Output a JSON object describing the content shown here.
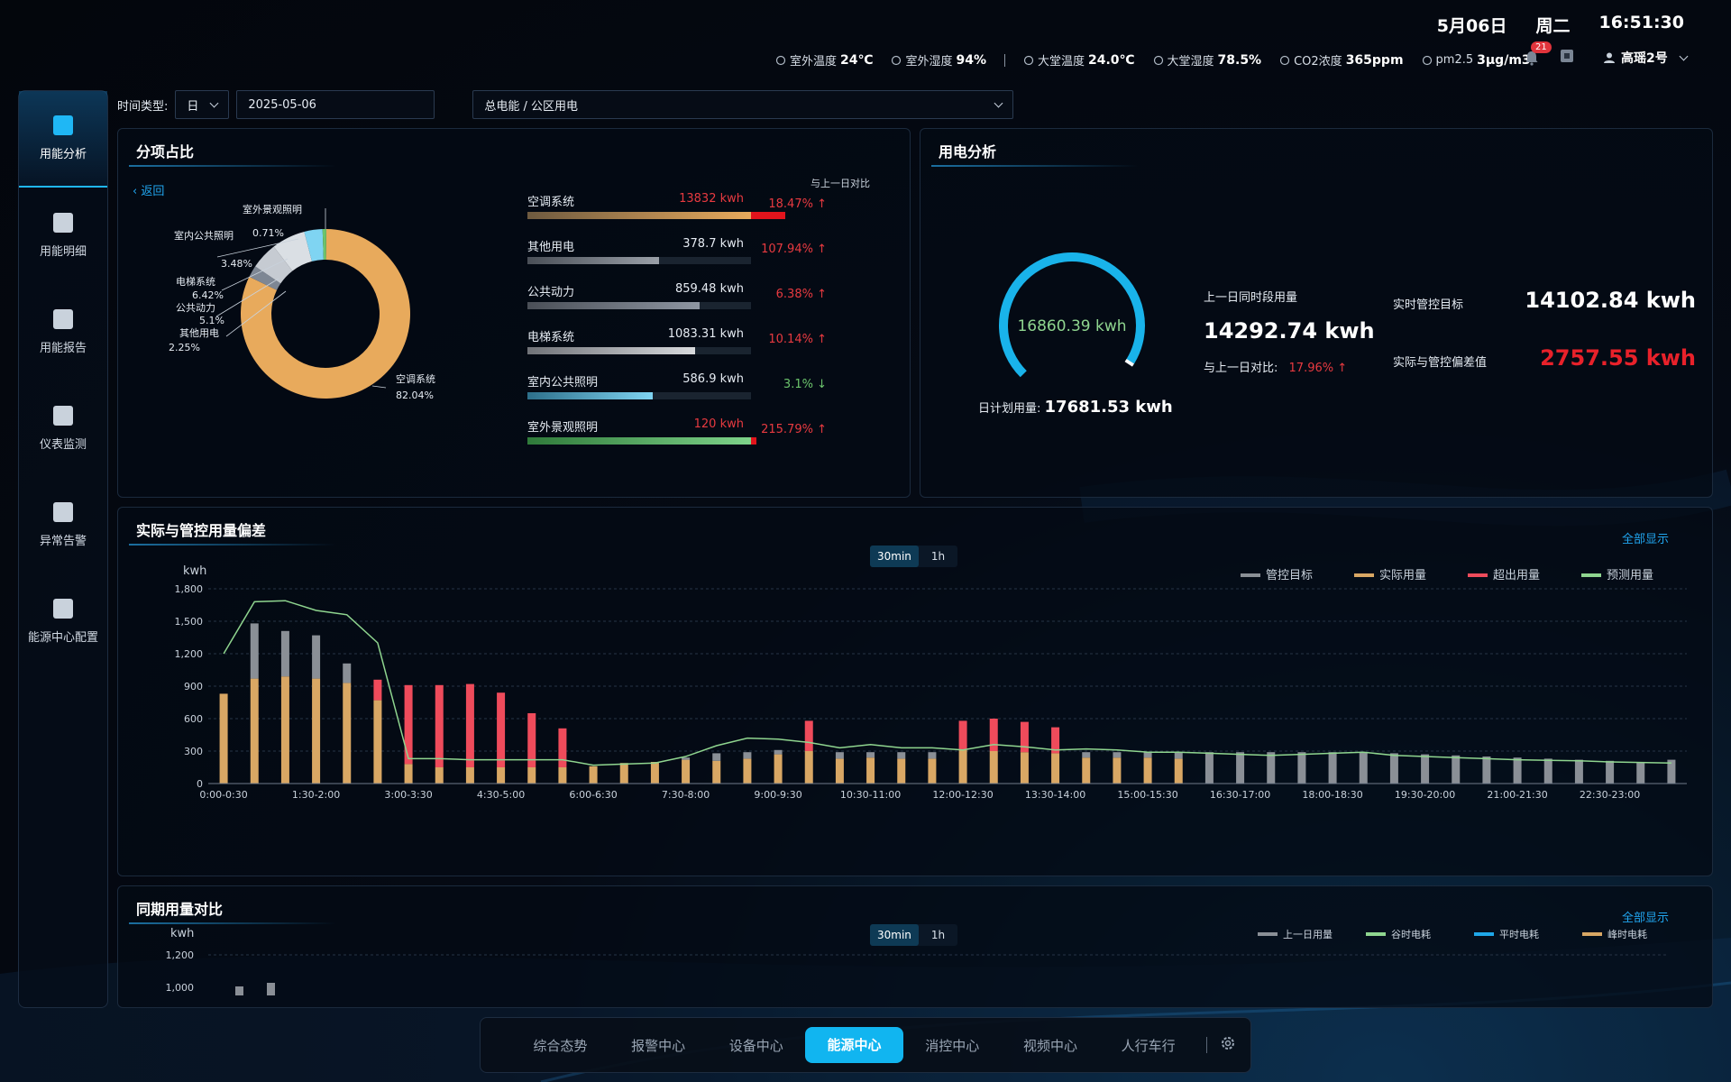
{
  "header": {
    "date": "5月06日",
    "weekday": "周二",
    "time": "16:51:30",
    "env": [
      {
        "label": "室外温度",
        "value": "24℃",
        "icon": "thermometer-icon"
      },
      {
        "label": "室外湿度",
        "value": "94%",
        "icon": "humidity-icon"
      },
      {
        "label": "大堂温度",
        "value": "24.0℃",
        "icon": "thermometer-icon"
      },
      {
        "label": "大堂湿度",
        "value": "78.5%",
        "icon": "droplet-icon"
      },
      {
        "label": "CO2浓度",
        "value": "365ppm",
        "icon": "cloud-icon"
      },
      {
        "label": "pm2.5",
        "value": "3μg/m3",
        "icon": "cloud-icon"
      }
    ],
    "notification_count": "21",
    "user_name": "高瑶2号"
  },
  "leftnav": [
    {
      "label": "用能分析",
      "icon": "bar-chart-icon",
      "active": true
    },
    {
      "label": "用能明细",
      "icon": "document-icon",
      "active": false
    },
    {
      "label": "用能报告",
      "icon": "clipboard-icon",
      "active": false
    },
    {
      "label": "仪表监测",
      "icon": "trend-icon",
      "active": false
    },
    {
      "label": "异常告警",
      "icon": "bell-icon",
      "active": false
    },
    {
      "label": "能源中心配置",
      "icon": "cube-icon",
      "active": false
    }
  ],
  "filters": {
    "time_type_label": "时间类型:",
    "time_type_value": "日",
    "date_value": "2025-05-06",
    "scope_value": "总电能 / 公区用电"
  },
  "share_panel": {
    "title": "分项占比",
    "back_label": "返回",
    "compare_header": "与上一日对比",
    "donut": {
      "labels": [
        {
          "name": "室外景观照明",
          "pct": "0.71%"
        },
        {
          "name": "室内公共照明",
          "pct": "3.48%"
        },
        {
          "name": "电梯系统",
          "pct": "6.42%"
        },
        {
          "name": "公共动力",
          "pct": "5.1%"
        },
        {
          "name": "其他用电",
          "pct": "2.25%"
        },
        {
          "name": "空调系统",
          "pct": "82.04%"
        }
      ],
      "values": [
        82.04,
        2.25,
        5.1,
        6.42,
        3.48,
        0.71
      ],
      "colors": [
        "#e8aa5c",
        "#7e8794",
        "#c6cbd2",
        "#dadfe4",
        "#7fd4f2",
        "#6cc46c"
      ]
    },
    "items": [
      {
        "name": "空调系统",
        "value": "13832 kwh",
        "value_red": true,
        "fill": 1.0,
        "overflow": true,
        "color": "linear-gradient(90deg,#6e5a40,#e8aa5c)",
        "pct": "18.47%",
        "dir": "↑",
        "up": true
      },
      {
        "name": "其他用电",
        "value": "378.7 kwh",
        "value_red": false,
        "fill": 0.59,
        "overflow": false,
        "color": "linear-gradient(90deg,#4a4f57,#9aa0a8)",
        "pct": "107.94%",
        "dir": "↑",
        "up": true
      },
      {
        "name": "公共动力",
        "value": "859.48 kwh",
        "value_red": false,
        "fill": 0.77,
        "overflow": false,
        "color": "linear-gradient(90deg,#4a4f57,#8e96a2)",
        "pct": "6.38%",
        "dir": "↑",
        "up": true
      },
      {
        "name": "电梯系统",
        "value": "1083.31 kwh",
        "value_red": false,
        "fill": 0.75,
        "overflow": false,
        "color": "linear-gradient(90deg,#707378,#d8dadd)",
        "pct": "10.14%",
        "dir": "↑",
        "up": true
      },
      {
        "name": "室内公共照明",
        "value": "586.9 kwh",
        "value_red": false,
        "fill": 0.56,
        "overflow": false,
        "color": "linear-gradient(90deg,#2d6f8a,#7fd4f2)",
        "pct": "3.1%",
        "dir": "↓",
        "up": false
      },
      {
        "name": "室外景观照明",
        "value": "120 kwh",
        "value_red": true,
        "fill": 1.0,
        "overflow": true,
        "color": "linear-gradient(90deg,#2f7a3a,#7ed38a)",
        "pct": "215.79%",
        "dir": "↑",
        "up": true
      }
    ]
  },
  "power_panel": {
    "title": "用电分析",
    "gauge_value": "16860.39 kwh",
    "gauge_fraction": 0.95,
    "plan_label": "日计划用量:",
    "plan_value": "17681.53 kwh",
    "prev_label": "上一日同时段用量",
    "prev_value": "14292.74 kwh",
    "compare_label": "与上一日对比:",
    "compare_value": "17.96%",
    "target_label": "实时管控目标",
    "target_value": "14102.84 kwh",
    "deviation_label": "实际与管控偏差值",
    "deviation_value": "2757.55 kwh"
  },
  "deviation_panel": {
    "title": "实际与管控用量偏差",
    "show_all": "全部显示",
    "tabs": [
      "30min",
      "1h"
    ],
    "chart_data": {
      "type": "bar",
      "ylabel": "kwh",
      "ylim": [
        0,
        1800
      ],
      "yticks": [
        "0",
        "300",
        "600",
        "900",
        "1,200",
        "1,500",
        "1,800"
      ],
      "xtick_labels": [
        "0:00-0:30",
        "1:30-2:00",
        "3:00-3:30",
        "4:30-5:00",
        "6:00-6:30",
        "7:30-8:00",
        "9:00-9:30",
        "10:30-11:00",
        "12:00-12:30",
        "13:30-14:00",
        "15:00-15:30",
        "16:30-17:00",
        "18:00-18:30",
        "19:30-20:00",
        "21:00-21:30",
        "22:30-23:00"
      ],
      "legend": [
        {
          "name": "管控目标",
          "color": "#8a8f96"
        },
        {
          "name": "实际用量",
          "color": "#d9a764"
        },
        {
          "name": "超出用量",
          "color": "#ef4b5b"
        },
        {
          "name": "预测用量",
          "color": "#8fd58f"
        }
      ],
      "series": [
        {
          "name": "管控目标",
          "values": [
            800,
            1480,
            1410,
            1370,
            1110,
            750,
            210,
            210,
            210,
            210,
            210,
            210,
            160,
            190,
            200,
            240,
            280,
            290,
            310,
            290,
            290,
            290,
            290,
            290,
            290,
            290,
            290,
            290,
            290,
            290,
            290,
            290,
            290,
            290,
            290,
            290,
            290,
            290,
            280,
            270,
            260,
            250,
            240,
            230,
            220,
            210,
            200,
            220
          ]
        },
        {
          "name": "实际用量",
          "values": [
            830,
            970,
            990,
            970,
            930,
            770,
            180,
            150,
            150,
            150,
            150,
            150,
            160,
            190,
            200,
            220,
            210,
            230,
            270,
            300,
            230,
            240,
            230,
            230,
            310,
            300,
            290,
            280,
            240,
            240,
            240,
            230,
            0,
            0,
            0,
            0,
            0,
            0,
            0,
            0,
            0,
            0,
            0,
            0,
            0,
            0,
            0,
            0
          ]
        },
        {
          "name": "超出用量",
          "values": [
            0,
            0,
            0,
            0,
            0,
            190,
            730,
            760,
            770,
            690,
            500,
            360,
            0,
            0,
            0,
            0,
            0,
            0,
            0,
            280,
            0,
            0,
            0,
            0,
            270,
            300,
            280,
            240,
            0,
            0,
            0,
            0,
            0,
            0,
            0,
            0,
            0,
            0,
            0,
            0,
            0,
            0,
            0,
            0,
            0,
            0,
            0,
            0
          ]
        },
        {
          "name": "预测用量",
          "values": [
            1200,
            1680,
            1690,
            1600,
            1560,
            1300,
            230,
            230,
            220,
            220,
            220,
            220,
            170,
            180,
            190,
            250,
            350,
            420,
            410,
            380,
            330,
            360,
            330,
            330,
            310,
            360,
            340,
            310,
            320,
            310,
            290,
            290,
            280,
            270,
            260,
            270,
            280,
            290,
            260,
            250,
            240,
            230,
            220,
            215,
            210,
            200,
            195,
            190
          ]
        }
      ]
    }
  },
  "period_panel": {
    "title": "同期用量对比",
    "show_all": "全部显示",
    "tabs": [
      "30min",
      "1h"
    ],
    "chart_data": {
      "type": "bar",
      "ylabel": "kwh",
      "yticks": [
        "1,200",
        "1,000"
      ],
      "legend": [
        {
          "name": "上一日用量",
          "color": "#8a8f96"
        },
        {
          "name": "谷时电耗",
          "color": "#8fd58f"
        },
        {
          "name": "平时电耗",
          "color": "#1fa7e8"
        },
        {
          "name": "峰时电耗",
          "color": "#d9a764"
        }
      ]
    }
  },
  "bottomnav": [
    {
      "label": "综合态势",
      "active": false
    },
    {
      "label": "报警中心",
      "active": false
    },
    {
      "label": "设备中心",
      "active": false
    },
    {
      "label": "能源中心",
      "active": true
    },
    {
      "label": "消控中心",
      "active": false
    },
    {
      "label": "视频中心",
      "active": false
    },
    {
      "label": "人行车行",
      "active": false
    }
  ]
}
